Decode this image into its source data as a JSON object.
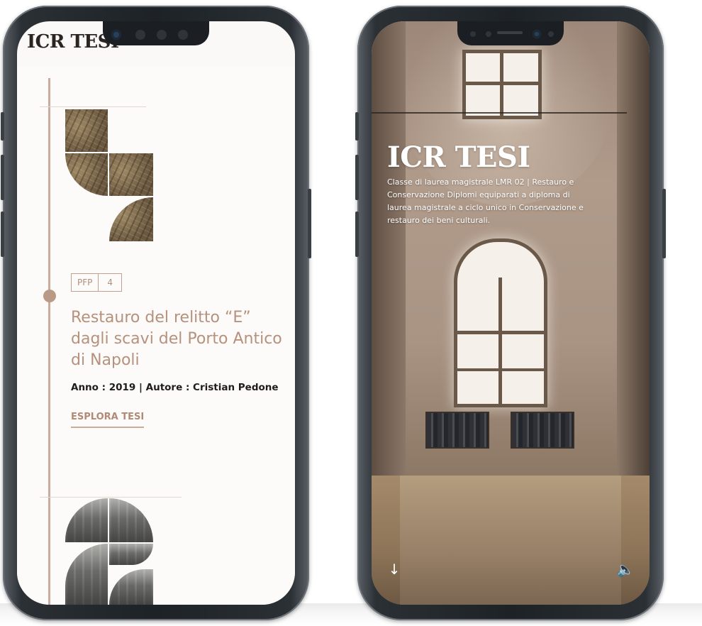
{
  "left_screen": {
    "site_title": "ICR TESI",
    "thesis": {
      "category_badge": "PFP",
      "number_badge": "4",
      "title": "Restauro del relitto “E” dagli scavi del Porto Antico di Napoli",
      "meta": "Anno : 2019 | Autore : Cristian Pedone",
      "cta": "ESPLORA TESI"
    }
  },
  "right_screen": {
    "hero_title": "ICR TESI",
    "hero_description": "Classe di laurea magistrale LMR 02 | Restauro e Conservazione Diplomi equiparati a diploma di laurea magistrale a ciclo unico in Conservazione e restauro dei beni culturali.",
    "scroll_down_glyph": "↓",
    "sound_glyph": "🔈"
  },
  "icons": [
    "down-arrow-icon",
    "speaker-icon"
  ],
  "colors": {
    "accent": "#b6917c",
    "timeline": "#c9ac9c",
    "background": "#fcfbf9",
    "text_dark": "#1f1c1a",
    "hero_text": "#ffffff"
  }
}
